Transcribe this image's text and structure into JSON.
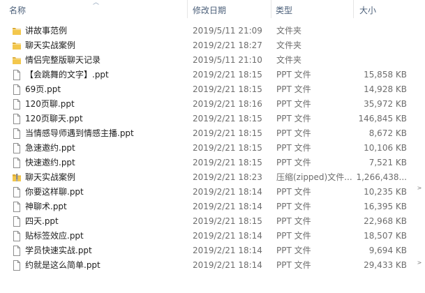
{
  "columns": {
    "name": "名称",
    "date": "修改日期",
    "type": "类型",
    "size": "大小"
  },
  "files": [
    {
      "icon": "folder-icon",
      "name": "讲故事范例",
      "date": "2019/5/11 21:09",
      "type": "文件夹",
      "size": ""
    },
    {
      "icon": "folder-icon",
      "name": "聊天实战案例",
      "date": "2019/2/21 18:27",
      "type": "文件夹",
      "size": ""
    },
    {
      "icon": "folder-icon",
      "name": "情侣完整版聊天记录",
      "date": "2019/5/11 21:10",
      "type": "文件夹",
      "size": ""
    },
    {
      "icon": "document-icon",
      "name": "【会跳舞的文字】.ppt",
      "date": "2019/2/21 18:15",
      "type": "PPT 文件",
      "size": "15,858 KB"
    },
    {
      "icon": "document-icon",
      "name": "69页.ppt",
      "date": "2019/2/21 18:15",
      "type": "PPT 文件",
      "size": "14,928 KB"
    },
    {
      "icon": "document-icon",
      "name": "120页聊.ppt",
      "date": "2019/2/21 18:16",
      "type": "PPT 文件",
      "size": "35,972 KB"
    },
    {
      "icon": "document-icon",
      "name": "120页聊天.ppt",
      "date": "2019/2/21 18:15",
      "type": "PPT 文件",
      "size": "146,845 KB"
    },
    {
      "icon": "document-icon",
      "name": "当情感导师遇到情感主播.ppt",
      "date": "2019/2/21 18:15",
      "type": "PPT 文件",
      "size": "8,672 KB"
    },
    {
      "icon": "document-icon",
      "name": "急速邀约.ppt",
      "date": "2019/2/21 18:15",
      "type": "PPT 文件",
      "size": "10,106 KB"
    },
    {
      "icon": "document-icon",
      "name": "快速邀约.ppt",
      "date": "2019/2/21 18:15",
      "type": "PPT 文件",
      "size": "7,521 KB"
    },
    {
      "icon": "zip-folder-icon",
      "name": "聊天实战案例",
      "date": "2019/2/21 18:23",
      "type": "压缩(zipped)文件...",
      "size": "1,266,438..."
    },
    {
      "icon": "document-icon",
      "name": "你要这样聊.ppt",
      "date": "2019/2/21 18:14",
      "type": "PPT 文件",
      "size": "10,235 KB"
    },
    {
      "icon": "document-icon",
      "name": "神聊术.ppt",
      "date": "2019/2/21 18:14",
      "type": "PPT 文件",
      "size": "16,395 KB"
    },
    {
      "icon": "document-icon",
      "name": "四天.ppt",
      "date": "2019/2/21 18:15",
      "type": "PPT 文件",
      "size": "22,968 KB"
    },
    {
      "icon": "document-icon",
      "name": "贴标签效应.ppt",
      "date": "2019/2/21 18:14",
      "type": "PPT 文件",
      "size": "18,507 KB"
    },
    {
      "icon": "document-icon",
      "name": "学员快速实战.ppt",
      "date": "2019/2/21 18:14",
      "type": "PPT 文件",
      "size": "9,694 KB"
    },
    {
      "icon": "document-icon",
      "name": "约就是这么简单.ppt",
      "date": "2019/2/21 18:14",
      "type": "PPT 文件",
      "size": "29,433 KB"
    }
  ],
  "colors": {
    "header_text": "#4c607a",
    "name_text": "#1e1e1e",
    "detail_text": "#6d6d6d",
    "folder_yellow": "#f3c74c"
  }
}
